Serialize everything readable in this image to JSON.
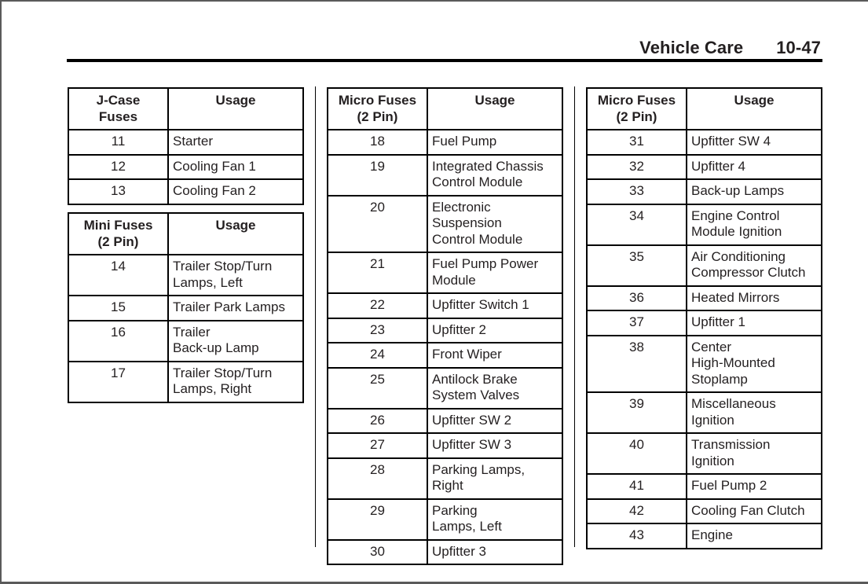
{
  "header": {
    "section": "Vehicle Care",
    "page_number": "10-47"
  },
  "tables": {
    "jcase": {
      "col1": "J-Case\nFuses",
      "col2": "Usage",
      "rows": [
        {
          "fuse": "11",
          "usage": "Starter"
        },
        {
          "fuse": "12",
          "usage": "Cooling Fan 1"
        },
        {
          "fuse": "13",
          "usage": "Cooling Fan 2"
        }
      ]
    },
    "mini": {
      "col1": "Mini Fuses\n(2 Pin)",
      "col2": "Usage",
      "rows": [
        {
          "fuse": "14",
          "usage": "Trailer Stop/Turn\nLamps, Left"
        },
        {
          "fuse": "15",
          "usage": "Trailer Park Lamps"
        },
        {
          "fuse": "16",
          "usage": "Trailer\nBack-up Lamp"
        },
        {
          "fuse": "17",
          "usage": "Trailer Stop/Turn\nLamps, Right"
        }
      ]
    },
    "micro1": {
      "col1": "Micro Fuses\n(2 Pin)",
      "col2": "Usage",
      "rows": [
        {
          "fuse": "18",
          "usage": "Fuel Pump"
        },
        {
          "fuse": "19",
          "usage": "Integrated Chassis\nControl Module"
        },
        {
          "fuse": "20",
          "usage": "Electronic\nSuspension\nControl Module"
        },
        {
          "fuse": "21",
          "usage": "Fuel Pump Power\nModule"
        },
        {
          "fuse": "22",
          "usage": "Upfitter Switch 1"
        },
        {
          "fuse": "23",
          "usage": "Upfitter 2"
        },
        {
          "fuse": "24",
          "usage": "Front Wiper"
        },
        {
          "fuse": "25",
          "usage": "Antilock Brake\nSystem Valves"
        },
        {
          "fuse": "26",
          "usage": "Upfitter SW 2"
        },
        {
          "fuse": "27",
          "usage": "Upfitter SW 3"
        },
        {
          "fuse": "28",
          "usage": "Parking Lamps,\nRight"
        },
        {
          "fuse": "29",
          "usage": "Parking\nLamps, Left"
        },
        {
          "fuse": "30",
          "usage": "Upfitter 3"
        }
      ]
    },
    "micro2": {
      "col1": "Micro Fuses\n(2 Pin)",
      "col2": "Usage",
      "rows": [
        {
          "fuse": "31",
          "usage": "Upfitter SW 4"
        },
        {
          "fuse": "32",
          "usage": "Upfitter 4"
        },
        {
          "fuse": "33",
          "usage": "Back-up Lamps"
        },
        {
          "fuse": "34",
          "usage": "Engine Control\nModule Ignition"
        },
        {
          "fuse": "35",
          "usage": "Air Conditioning\nCompressor Clutch"
        },
        {
          "fuse": "36",
          "usage": "Heated Mirrors"
        },
        {
          "fuse": "37",
          "usage": "Upfitter 1"
        },
        {
          "fuse": "38",
          "usage": "Center\nHigh-Mounted\nStoplamp"
        },
        {
          "fuse": "39",
          "usage": "Miscellaneous\nIgnition"
        },
        {
          "fuse": "40",
          "usage": "Transmission\nIgnition"
        },
        {
          "fuse": "41",
          "usage": "Fuel Pump 2"
        },
        {
          "fuse": "42",
          "usage": "Cooling Fan Clutch"
        },
        {
          "fuse": "43",
          "usage": "Engine"
        }
      ]
    }
  }
}
